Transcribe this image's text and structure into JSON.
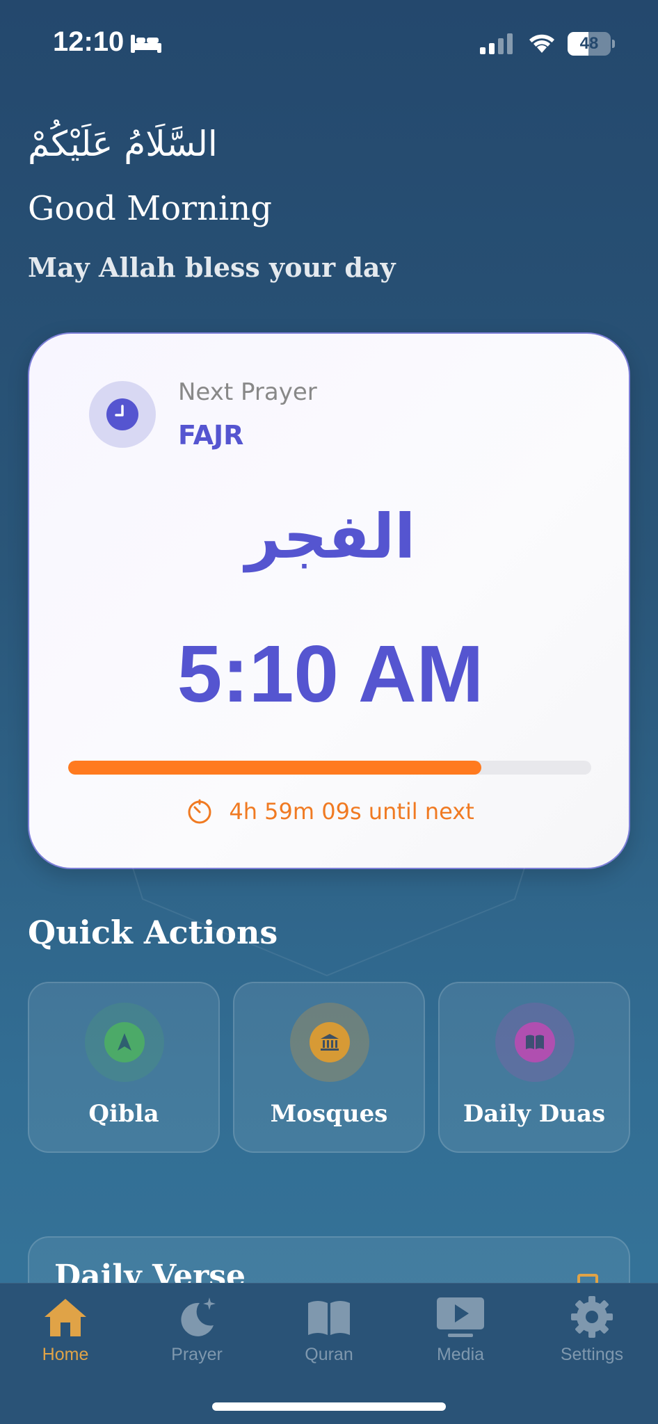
{
  "status_bar": {
    "time": "12:10",
    "battery_level": "48",
    "battery_percent": 48,
    "icons": [
      "bed-icon",
      "cellular-signal-icon",
      "wifi-icon",
      "battery-icon"
    ]
  },
  "greeting": {
    "arabic": "السَّلَامُ عَلَيْكُمْ",
    "title": "Good Morning",
    "subtitle": "May Allah bless your day"
  },
  "next_prayer": {
    "label": "Next Prayer",
    "name": "FAJR",
    "arabic_name": "الفجر",
    "time": "5:10 AM",
    "progress_percent": 79,
    "countdown": "4h 59m 09s until next",
    "icons": [
      "clock-icon",
      "timer-icon"
    ]
  },
  "quick_actions": {
    "title": "Quick Actions",
    "items": [
      {
        "label": "Qibla",
        "icon": "compass-arrow-icon",
        "color": "#4caa68"
      },
      {
        "label": "Mosques",
        "icon": "mosque-building-icon",
        "color": "#d79a35"
      },
      {
        "label": "Daily Duas",
        "icon": "book-icon",
        "color": "#b04fb0"
      }
    ]
  },
  "daily_verse": {
    "title": "Daily Verse",
    "icon": "bookmark-icon"
  },
  "tab_bar": {
    "active": "Home",
    "items": [
      {
        "label": "Home",
        "icon": "house-icon"
      },
      {
        "label": "Prayer",
        "icon": "moon-stars-icon"
      },
      {
        "label": "Quran",
        "icon": "open-book-icon"
      },
      {
        "label": "Media",
        "icon": "play-screen-icon"
      },
      {
        "label": "Settings",
        "icon": "gear-icon"
      }
    ]
  },
  "colors": {
    "accent_purple": "#5555d0",
    "accent_orange": "#ff7a1f",
    "tab_active": "#e0a347",
    "tab_inactive": "#7f98ae"
  }
}
